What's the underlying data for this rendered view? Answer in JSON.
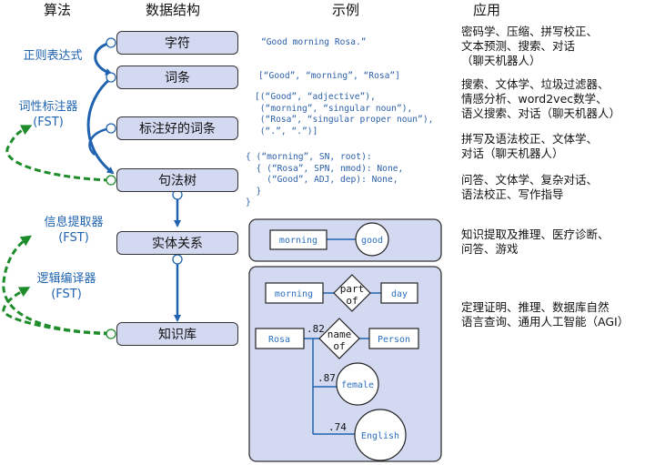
{
  "headers": {
    "algorithm": "算法",
    "data_structure": "数据结构",
    "example": "示例",
    "application": "应用"
  },
  "data_structures": [
    {
      "label": "字符"
    },
    {
      "label": "词条"
    },
    {
      "label": "标注好的词条"
    },
    {
      "label": "句法树"
    },
    {
      "label": "实体关系"
    },
    {
      "label": "知识库"
    }
  ],
  "algorithms": [
    {
      "line1": "正则表达式",
      "line2": ""
    },
    {
      "line1": "词性标注器",
      "line2": "(FST)"
    },
    {
      "line1": "信息提取器",
      "line2": "(FST)"
    },
    {
      "line1": "逻辑编译器",
      "line2": "(FST)"
    }
  ],
  "examples": {
    "characters": "“Good morning Rosa.”",
    "tokens": "[“Good”, “morning”, “Rosa”]",
    "tagged": "[(“Good”, “adjective”),\n (“morning”, “singular noun”),\n (“Rosa”, “singular proper noun”),\n (“.”, “.”)]",
    "tree": "{ (“morning”, SN, root):\n  { (“Rosa”, SPN, nmod): None,\n    (“Good”, ADJ, dep): None,\n  }\n}"
  },
  "entity_relation": {
    "entity": "morning",
    "attribute": "good"
  },
  "knowledge_base": {
    "nodes": {
      "morning": "morning",
      "part_of": "part of",
      "day": "day",
      "rosa": "Rosa",
      "name_of": "name of",
      "person": "Person",
      "female": "female",
      "english": "English"
    },
    "weights": {
      "rosa_name_of": ".82",
      "rosa_female": ".87",
      "rosa_english": ".74"
    }
  },
  "applications": [
    "密码学、压缩、拼写校正、\n文本预测、搜索、对话\n（聊天机器人）",
    "搜索、文体学、垃圾过滤器、\n情感分析、word2vec数学、\n语义搜索、对话（聊天机器人）",
    "拼写及语法校正、文体学、\n对话（聊天机器人）",
    "问答、文体学、复杂对话、\n语法校正、写作指导",
    "知识提取及推理、医疗诊断、\n问答、游戏",
    "定理证明、推理、数据库自然\n语言查询、通用人工智能（AGI）"
  ],
  "colors": {
    "box_fill": "#d4d9f2",
    "algorithm_blue": "#1f63b0",
    "fst_green": "#1e8c2a",
    "code_blue": "#2b5fa8"
  }
}
